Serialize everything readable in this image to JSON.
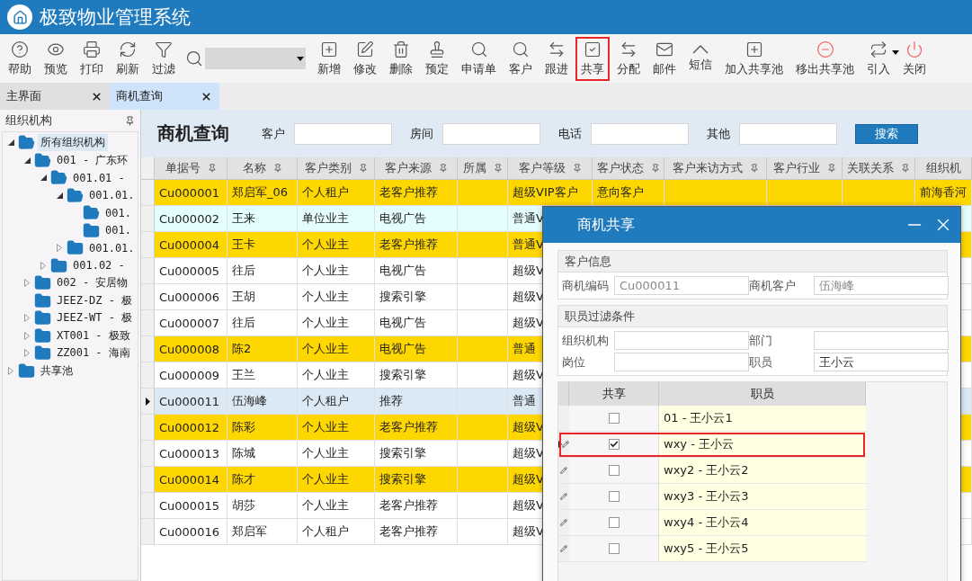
{
  "app": {
    "title": "极致物业管理系统"
  },
  "toolbar": {
    "items": [
      {
        "kind": "button",
        "label": "帮助",
        "highlighted": false,
        "dropdown": false
      },
      {
        "kind": "button",
        "label": "预览",
        "highlighted": false,
        "dropdown": false
      },
      {
        "kind": "button",
        "label": "打印",
        "highlighted": false,
        "dropdown": false
      },
      {
        "kind": "button",
        "label": "刷新",
        "highlighted": false,
        "dropdown": false
      },
      {
        "kind": "button",
        "label": "过滤",
        "highlighted": false,
        "dropdown": false
      },
      {
        "kind": "combo"
      },
      {
        "kind": "button",
        "label": "新增",
        "highlighted": false,
        "dropdown": false
      },
      {
        "kind": "button",
        "label": "修改",
        "highlighted": false,
        "dropdown": false
      },
      {
        "kind": "button",
        "label": "删除",
        "highlighted": false,
        "dropdown": false
      },
      {
        "kind": "button",
        "label": "预定",
        "highlighted": false,
        "dropdown": false
      },
      {
        "kind": "button",
        "label": "申请单",
        "highlighted": false,
        "dropdown": false
      },
      {
        "kind": "button",
        "label": "客户",
        "highlighted": false,
        "dropdown": false
      },
      {
        "kind": "button",
        "label": "跟进",
        "highlighted": false,
        "dropdown": false
      },
      {
        "kind": "button",
        "label": "共享",
        "highlighted": true,
        "dropdown": false
      },
      {
        "kind": "button",
        "label": "分配",
        "highlighted": false,
        "dropdown": false
      },
      {
        "kind": "button",
        "label": "邮件",
        "highlighted": false,
        "dropdown": false
      },
      {
        "kind": "button",
        "label": "短信",
        "highlighted": false,
        "dropdown": false
      },
      {
        "kind": "button",
        "label": "加入共享池",
        "highlighted": false,
        "dropdown": false
      },
      {
        "kind": "button",
        "label": "移出共享池",
        "highlighted": false,
        "dropdown": false
      },
      {
        "kind": "button",
        "label": "引入",
        "highlighted": false,
        "dropdown": true
      },
      {
        "kind": "button",
        "label": "关闭",
        "highlighted": false,
        "dropdown": false
      }
    ]
  },
  "tabs": [
    {
      "label": "主界面",
      "selected": false
    },
    {
      "label": "商机查询",
      "selected": true
    }
  ],
  "sidebar": {
    "title": "组织机构",
    "nodes": [
      {
        "label": "所有组织机构",
        "selected": true,
        "expanded": true,
        "children": [
          {
            "label": "001 - 广东环",
            "selected": false,
            "expanded": true,
            "children": [
              {
                "label": "001.01 -",
                "selected": false,
                "expanded": true,
                "children": [
                  {
                    "label": "001.01.",
                    "selected": false,
                    "expanded": true,
                    "children": [
                      {
                        "label": "001.",
                        "selected": false,
                        "open": true
                      },
                      {
                        "label": "001.",
                        "selected": false,
                        "open": false
                      }
                    ]
                  },
                  {
                    "label": "001.01.",
                    "selected": false,
                    "expanded": false
                  }
                ]
              },
              {
                "label": "001.02 -",
                "selected": false,
                "expanded": false
              }
            ]
          },
          {
            "label": "002 - 安居物",
            "selected": false,
            "expanded": false
          },
          {
            "label": "JEEZ-DZ - 极",
            "selected": false
          },
          {
            "label": "JEEZ-WT - 极",
            "selected": false,
            "expanded": false
          },
          {
            "label": "XT001 - 极致",
            "selected": false,
            "expanded": false
          },
          {
            "label": "ZZ001 - 海南",
            "selected": false,
            "expanded": false
          }
        ]
      },
      {
        "label": "共享池",
        "selected": false,
        "expanded": false
      }
    ]
  },
  "query": {
    "title": "商机查询",
    "filters": [
      {
        "label": "客户"
      },
      {
        "label": "房间"
      },
      {
        "label": "电话"
      },
      {
        "label": "其他"
      }
    ],
    "search_button": "搜索"
  },
  "table": {
    "columns": [
      {
        "label": "单据号",
        "pinned": true
      },
      {
        "label": "名称",
        "pinned": true
      },
      {
        "label": "客户类别",
        "pinned": true
      },
      {
        "label": "客户来源",
        "pinned": true
      },
      {
        "label": "所属",
        "pinned": true
      },
      {
        "label": "客户等级",
        "pinned": true
      },
      {
        "label": "客户状态",
        "pinned": true
      },
      {
        "label": "客户来访方式",
        "pinned": true
      },
      {
        "label": "客户行业",
        "pinned": true
      },
      {
        "label": "关联关系",
        "pinned": true
      },
      {
        "label": "组织机",
        "pinned": false
      }
    ],
    "rows": [
      {
        "color": "#ffd700",
        "selected": false,
        "cells": [
          "Cu000001",
          "郑启军_06",
          "个人租户",
          "老客户推荐",
          null,
          "超级VIP客户",
          "意向客户",
          null,
          null,
          null,
          "前海香河"
        ]
      },
      {
        "color": "#e4fdfd",
        "selected": false,
        "cells": [
          "Cu000002",
          "王来",
          "单位业主",
          "电视广告",
          null,
          "普通V"
        ]
      },
      {
        "color": "#ffd700",
        "selected": false,
        "cells": [
          "Cu000004",
          "王卡",
          "个人业主",
          "老客户推荐",
          null,
          "普通V"
        ]
      },
      {
        "color": "#ffffff",
        "selected": false,
        "cells": [
          "Cu000005",
          "往后",
          "个人业主",
          "电视广告",
          null,
          "超级V"
        ]
      },
      {
        "color": "#ffffff",
        "selected": false,
        "cells": [
          "Cu000006",
          "王胡",
          "个人业主",
          "搜索引擎",
          null,
          "超级V"
        ]
      },
      {
        "color": "#ffffff",
        "selected": false,
        "cells": [
          "Cu000007",
          "往后",
          "个人业主",
          "电视广告",
          null,
          "超级V"
        ]
      },
      {
        "color": "#ffd700",
        "selected": false,
        "cells": [
          "Cu000008",
          "陈2",
          "个人业主",
          "电视广告",
          null,
          "普通"
        ]
      },
      {
        "color": "#ffffff",
        "selected": false,
        "cells": [
          "Cu000009",
          "王兰",
          "个人业主",
          "搜索引擎",
          null,
          "超级V"
        ]
      },
      {
        "selected": true,
        "cells": [
          "Cu000011",
          "伍海峰",
          "个人租户",
          "推荐",
          null,
          "普通"
        ]
      },
      {
        "color": "#ffd700",
        "selected": false,
        "cells": [
          "Cu000012",
          "陈彩",
          "个人业主",
          "老客户推荐",
          null,
          "超级V"
        ]
      },
      {
        "color": "#ffffff",
        "selected": false,
        "cells": [
          "Cu000013",
          "陈城",
          "个人业主",
          "搜索引擎",
          null,
          "超级V"
        ]
      },
      {
        "color": "#ffd700",
        "selected": false,
        "cells": [
          "Cu000014",
          "陈才",
          "个人业主",
          "搜索引擎",
          null,
          "超级V"
        ]
      },
      {
        "color": "#ffffff",
        "selected": false,
        "cells": [
          "Cu000015",
          "胡莎",
          "个人业主",
          "老客户推荐",
          null,
          "超级V"
        ]
      },
      {
        "color": "#ffffff",
        "selected": false,
        "cells": [
          "Cu000016",
          "郑启军",
          "个人租户",
          "老客户推荐",
          null,
          "超级V"
        ]
      }
    ]
  },
  "dialog": {
    "title": "商机共享",
    "customer_section": {
      "title": "客户信息",
      "fields": [
        {
          "label": "商机编码",
          "value": "Cu000011"
        },
        {
          "label": "商机客户",
          "value": "伍海峰"
        }
      ]
    },
    "filter_section": {
      "title": "职员过滤条件",
      "fields": [
        {
          "label": "组织机构"
        },
        {
          "label": "部门"
        },
        {
          "label": "岗位"
        },
        {
          "label": "职员",
          "value": "王小云"
        }
      ]
    },
    "grid": {
      "columns": [
        "共享",
        "职员"
      ],
      "rows": [
        {
          "label": "01 - 王小云1",
          "checked": false,
          "current": false,
          "editing": false,
          "highlighted": false
        },
        {
          "label": "wxy - 王小云",
          "checked": true,
          "current": true,
          "editing": true,
          "highlighted": true
        },
        {
          "label": "wxy2 - 王小云2",
          "checked": false,
          "current": false,
          "editing": true,
          "highlighted": false
        },
        {
          "label": "wxy3 - 王小云3",
          "checked": false,
          "current": false,
          "editing": true,
          "highlighted": false
        },
        {
          "label": "wxy4 - 王小云4",
          "checked": false,
          "current": false,
          "editing": true,
          "highlighted": false
        },
        {
          "label": "wxy5 - 王小云5",
          "checked": false,
          "current": false,
          "editing": true,
          "highlighted": false
        }
      ]
    }
  }
}
